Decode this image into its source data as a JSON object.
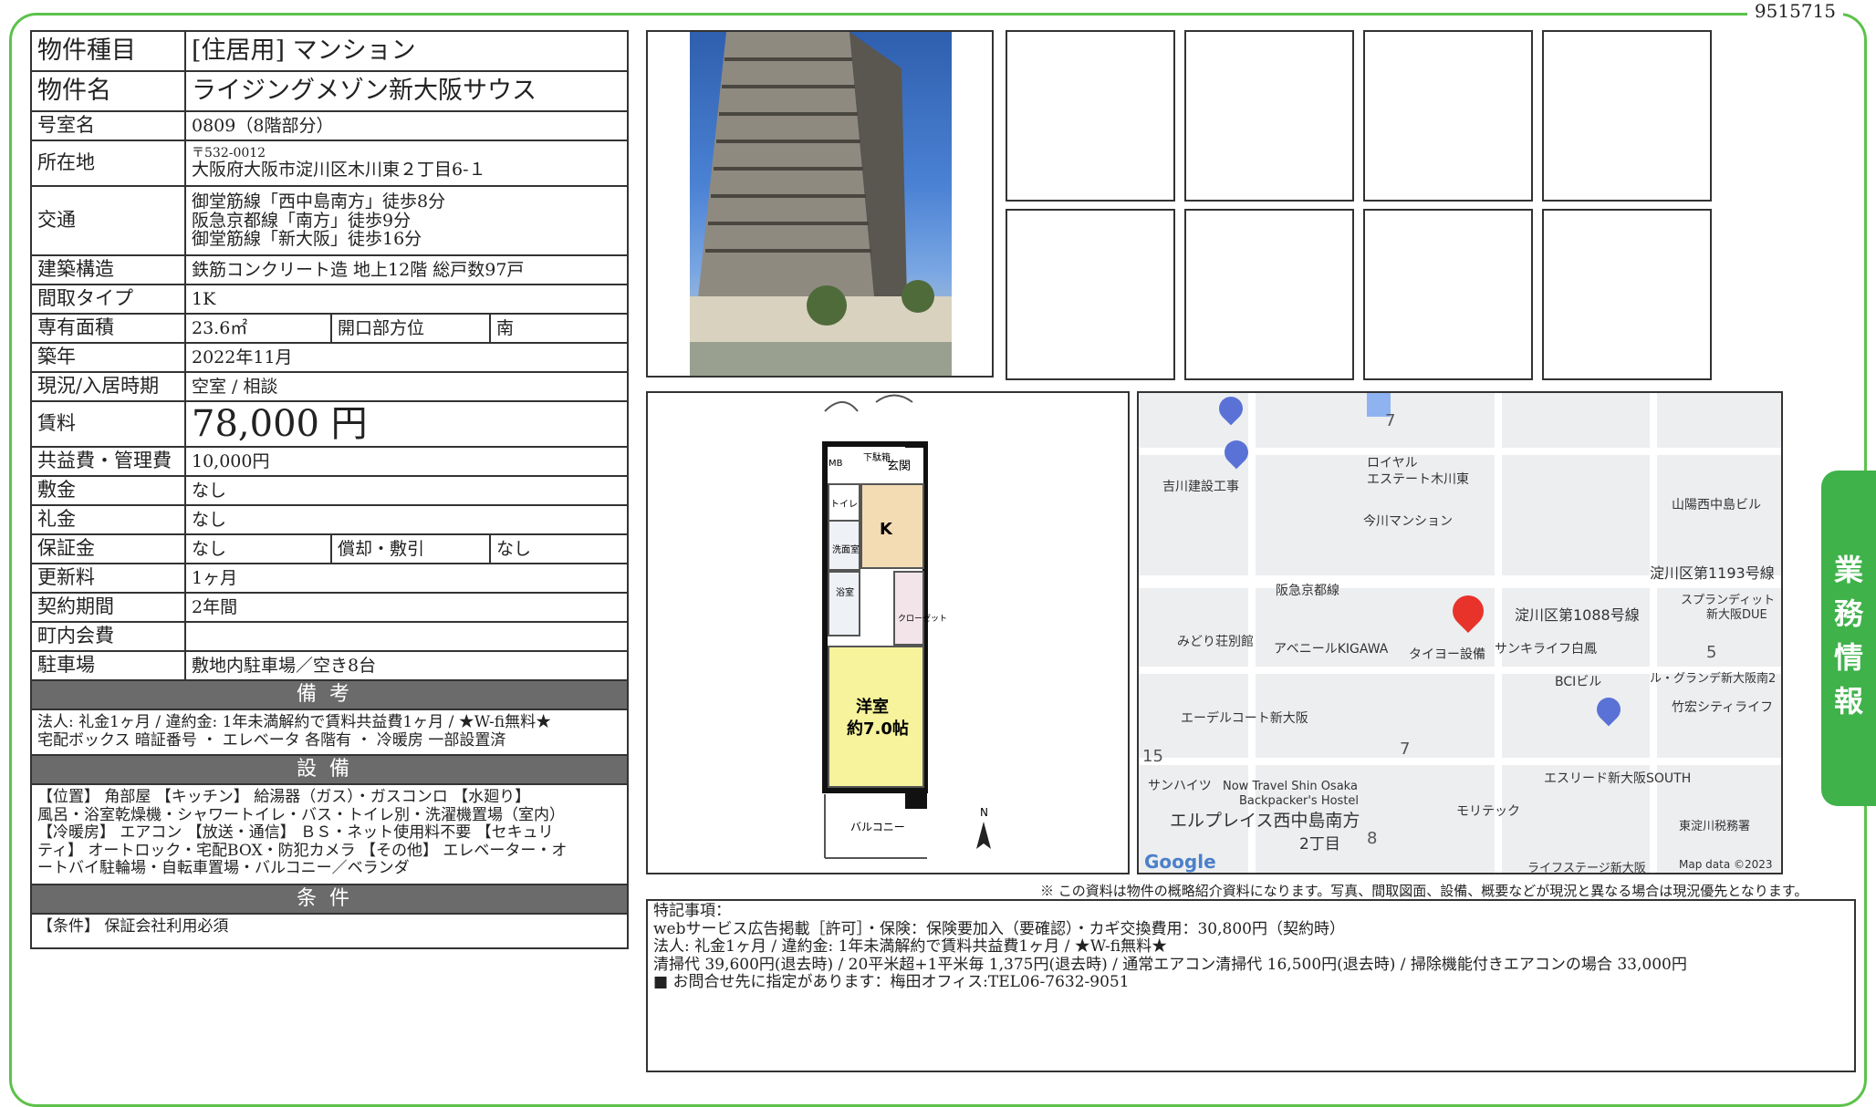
{
  "doc_id": "9515715",
  "spec": {
    "type_label": "物件種目",
    "type_value": "[住居用] マンション",
    "name_label": "物件名",
    "name_value": "ライジングメゾン新大阪サウス",
    "room_label": "号室名",
    "room_value": "0809（8階部分）",
    "addr_label": "所在地",
    "addr_postal": "〒532-0012",
    "addr_value": "大阪府大阪市淀川区木川東２丁目6-１",
    "transit_label": "交通",
    "transit_1": "御堂筋線「西中島南方」徒歩8分",
    "transit_2": "阪急京都線「南方」徒歩9分",
    "transit_3": "御堂筋線「新大阪」徒歩16分",
    "structure_label": "建築構造",
    "structure_value": "鉄筋コンクリート造 地上12階 総戸数97戸",
    "layout_label": "間取タイプ",
    "layout_value": "1K",
    "area_label": "専有面積",
    "area_value": "23.6㎡",
    "direction_label": "開口部方位",
    "direction_value": "南",
    "built_label": "築年",
    "built_value": "2022年11月",
    "status_label": "現況/入居時期",
    "status_value": "空室 /  相談",
    "rent_label": "賃料",
    "rent_value": "78,000 円",
    "fee_label": "共益費・管理費",
    "fee_value": "10,000円",
    "deposit_label": "敷金",
    "deposit_value": "なし",
    "keymoney_label": "礼金",
    "keymoney_value": "なし",
    "guarantee_label": "保証金",
    "guarantee_value": "なし",
    "amort_label": "償却・敷引",
    "amort_value": "なし",
    "renewal_label": "更新料",
    "renewal_value": "1ヶ月",
    "contract_label": "契約期間",
    "contract_value": "2年間",
    "assoc_label": "町内会費",
    "assoc_value": "",
    "parking_label": "駐車場",
    "parking_value": "敷地内駐車場／空き8台",
    "remarks_header": "備考",
    "remarks_1": "法人: 礼金1ヶ月  /  違約金: 1年未満解約で賃料共益費1ヶ月  /  ★W-fi無料★",
    "remarks_2": "宅配ボックス 暗証番号 ・ エレベータ 各階有 ・ 冷暖房 一部設置済",
    "equip_header": "設備",
    "equip_1": "【位置】 角部屋 【キッチン】 給湯器（ガス）・ガスコンロ 【水廻り】",
    "equip_2": "風呂・浴室乾燥機・シャワートイレ・バス・トイレ別・洗濯機置場（室内）",
    "equip_3": "【冷暖房】 エアコン 【放送・通信】 ＢＳ・ネット使用料不要 【セキュリ",
    "equip_4": "ティ】 オートロック・宅配BOX・防犯カメラ 【その他】 エレベーター・オ",
    "equip_5": "ートバイ駐輪場・自転車置場・バルコニー／ベランダ",
    "cond_header": "条件",
    "cond_1": "【条件】 保証会社利用必須"
  },
  "floorplan": {
    "room_name": "洋室",
    "room_size": "約7.0帖",
    "entrance": "玄関",
    "shoe": "下駄箱",
    "mb": "MB",
    "toilet": "トイレ",
    "kitchen": "K",
    "wash": "洗面室",
    "bath": "浴室",
    "closet": "クローゼット",
    "balcony": "バルコニー",
    "north": "N"
  },
  "map": {
    "labels": {
      "l1": "ロイヤル",
      "l2": "エステート木川東",
      "l3": "吉川建設工事",
      "l4": "今川マンション",
      "l5": "山陽西中島ビル",
      "l6": "淀川区第1193号線",
      "l7": "阪急京都線",
      "l8": "淀川区第1088号線",
      "l9": "スプランディット",
      "l10": "新大阪DUE",
      "l11": "みどり荘別館",
      "l12": "アベニールKIGAWA",
      "l13": "タイヨー設備",
      "l14": "サンキライフ白鳳",
      "l15": "BCIビル",
      "l16": "ル・グランデ新大阪南2",
      "l17": "竹宏シティライフ",
      "l18": "エーデルコート新大阪",
      "l19": "サンハイツ",
      "l20": "Now Travel Shin Osaka",
      "l21": "Backpacker's Hostel",
      "l22": "モリテック",
      "l23": "エスリード新大阪SOUTH",
      "l24": "東淀川税務署",
      "l25": "エルプレイス西中島南方",
      "l26": "2丁目",
      "l27": "ライフステージ新大阪",
      "l28": "Map data ©2023",
      "logo": "Google"
    },
    "numbers": {
      "n1": "7",
      "n2": "5",
      "n3": "7",
      "n4": "15",
      "n5": "8"
    },
    "colors": {
      "pin": "#e8332b",
      "parking": "#5a72d6",
      "poi": "#7a7f86"
    }
  },
  "disclaimer": "※ この資料は物件の概略紹介資料になります。写真、間取図面、設備、概要などが現況と異なる場合は現況優先となります。",
  "notes": {
    "title": "特記事項：",
    "line1": "webサービス広告掲載［許可］・保険：保険要加入（要確認）・カギ交換費用：30,800円（契約時）",
    "line2": "法人: 礼金1ヶ月  /  違約金: 1年未満解約で賃料共益費1ヶ月  /  ★W-fi無料★",
    "line3": "清掃代 39,600円(退去時)  /  20平米超+1平米毎 1,375円(退去時)  /  通常エアコン清掃代 16,500円(退去時)  /  掃除機能付きエアコンの場合 33,000円",
    "line4": "■ お問合せ先に指定があります：梅田オフィス:TEL06-7632-9051"
  },
  "side_tab": {
    "c1": "業",
    "c2": "務",
    "c3": "情",
    "c4": "報"
  },
  "colors": {
    "frame_green": "#5cc24a",
    "tab_green": "#3fb24a",
    "header_gray": "#6b6b6b"
  }
}
